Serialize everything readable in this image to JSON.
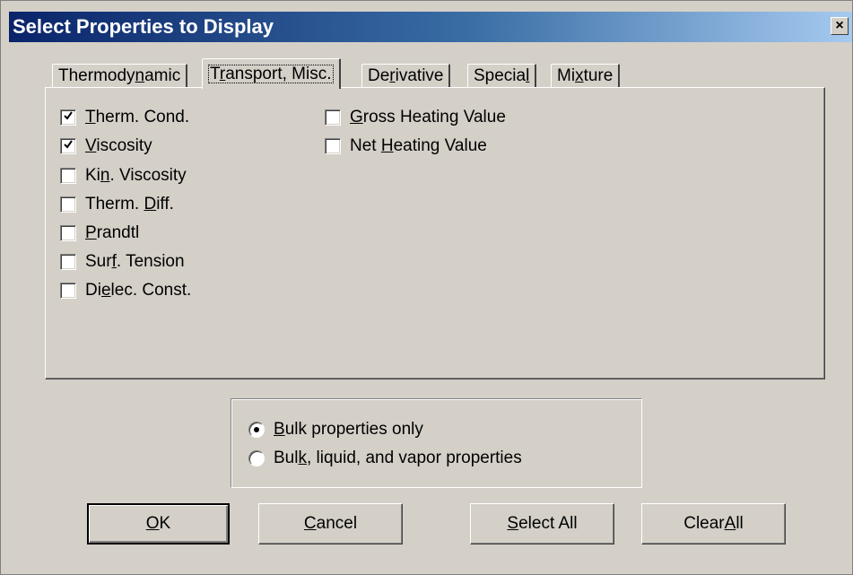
{
  "window": {
    "title": "Select Properties to Display",
    "close_glyph": "×"
  },
  "tabs": [
    {
      "pre": "Thermody",
      "ul": "n",
      "post": "amic",
      "selected": false
    },
    {
      "pre": "T",
      "ul": "r",
      "post": "ansport, Misc.",
      "selected": true
    },
    {
      "pre": "De",
      "ul": "r",
      "post": "ivative",
      "selected": false
    },
    {
      "pre": "Specia",
      "ul": "l",
      "post": "",
      "selected": false
    },
    {
      "pre": "Mi",
      "ul": "x",
      "post": "ture",
      "selected": false
    }
  ],
  "properties_left": [
    {
      "pre": "",
      "ul": "T",
      "post": "herm. Cond.",
      "checked": true
    },
    {
      "pre": "",
      "ul": "V",
      "post": "iscosity",
      "checked": true
    },
    {
      "pre": "Ki",
      "ul": "n",
      "post": ". Viscosity",
      "checked": false
    },
    {
      "pre": "Therm. ",
      "ul": "D",
      "post": "iff.",
      "checked": false
    },
    {
      "pre": "",
      "ul": "P",
      "post": "randtl",
      "checked": false
    },
    {
      "pre": "Sur",
      "ul": "f",
      "post": ". Tension",
      "checked": false
    },
    {
      "pre": "Di",
      "ul": "e",
      "post": "lec. Const.",
      "checked": false
    }
  ],
  "properties_right": [
    {
      "pre": "",
      "ul": "G",
      "post": "ross Heating Value",
      "checked": false
    },
    {
      "pre": "Net ",
      "ul": "H",
      "post": "eating Value",
      "checked": false
    }
  ],
  "display_mode": {
    "options": [
      {
        "pre": "",
        "ul": "B",
        "post": "ulk properties only",
        "selected": true
      },
      {
        "pre": "Bul",
        "ul": "k",
        "post": ", liquid, and vapor properties",
        "selected": false
      }
    ]
  },
  "buttons": {
    "ok": {
      "pre": "",
      "ul": "O",
      "post": "K"
    },
    "cancel": {
      "pre": "",
      "ul": "C",
      "post": "ancel"
    },
    "select_all": {
      "pre": "",
      "ul": "S",
      "post": "elect All"
    },
    "clear_all": {
      "pre": "Clear ",
      "ul": "A",
      "post": "ll"
    }
  },
  "colors": {
    "face": "#d4d0c8",
    "title_start": "#0a246a",
    "title_end": "#a6caf0"
  },
  "icons": {
    "check": "check-icon",
    "close": "close-icon",
    "radio_dot": "radio-dot-icon"
  }
}
